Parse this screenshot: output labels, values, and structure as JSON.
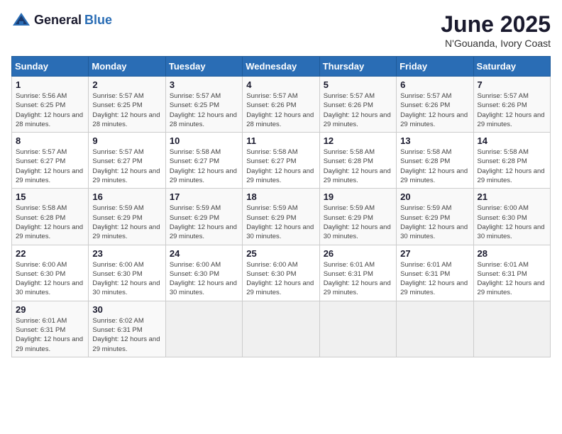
{
  "header": {
    "logo_general": "General",
    "logo_blue": "Blue",
    "month": "June 2025",
    "location": "N'Gouanda, Ivory Coast"
  },
  "weekdays": [
    "Sunday",
    "Monday",
    "Tuesday",
    "Wednesday",
    "Thursday",
    "Friday",
    "Saturday"
  ],
  "weeks": [
    [
      {
        "day": "1",
        "sunrise": "Sunrise: 5:56 AM",
        "sunset": "Sunset: 6:25 PM",
        "daylight": "Daylight: 12 hours and 28 minutes."
      },
      {
        "day": "2",
        "sunrise": "Sunrise: 5:57 AM",
        "sunset": "Sunset: 6:25 PM",
        "daylight": "Daylight: 12 hours and 28 minutes."
      },
      {
        "day": "3",
        "sunrise": "Sunrise: 5:57 AM",
        "sunset": "Sunset: 6:25 PM",
        "daylight": "Daylight: 12 hours and 28 minutes."
      },
      {
        "day": "4",
        "sunrise": "Sunrise: 5:57 AM",
        "sunset": "Sunset: 6:26 PM",
        "daylight": "Daylight: 12 hours and 28 minutes."
      },
      {
        "day": "5",
        "sunrise": "Sunrise: 5:57 AM",
        "sunset": "Sunset: 6:26 PM",
        "daylight": "Daylight: 12 hours and 29 minutes."
      },
      {
        "day": "6",
        "sunrise": "Sunrise: 5:57 AM",
        "sunset": "Sunset: 6:26 PM",
        "daylight": "Daylight: 12 hours and 29 minutes."
      },
      {
        "day": "7",
        "sunrise": "Sunrise: 5:57 AM",
        "sunset": "Sunset: 6:26 PM",
        "daylight": "Daylight: 12 hours and 29 minutes."
      }
    ],
    [
      {
        "day": "8",
        "sunrise": "Sunrise: 5:57 AM",
        "sunset": "Sunset: 6:27 PM",
        "daylight": "Daylight: 12 hours and 29 minutes."
      },
      {
        "day": "9",
        "sunrise": "Sunrise: 5:57 AM",
        "sunset": "Sunset: 6:27 PM",
        "daylight": "Daylight: 12 hours and 29 minutes."
      },
      {
        "day": "10",
        "sunrise": "Sunrise: 5:58 AM",
        "sunset": "Sunset: 6:27 PM",
        "daylight": "Daylight: 12 hours and 29 minutes."
      },
      {
        "day": "11",
        "sunrise": "Sunrise: 5:58 AM",
        "sunset": "Sunset: 6:27 PM",
        "daylight": "Daylight: 12 hours and 29 minutes."
      },
      {
        "day": "12",
        "sunrise": "Sunrise: 5:58 AM",
        "sunset": "Sunset: 6:28 PM",
        "daylight": "Daylight: 12 hours and 29 minutes."
      },
      {
        "day": "13",
        "sunrise": "Sunrise: 5:58 AM",
        "sunset": "Sunset: 6:28 PM",
        "daylight": "Daylight: 12 hours and 29 minutes."
      },
      {
        "day": "14",
        "sunrise": "Sunrise: 5:58 AM",
        "sunset": "Sunset: 6:28 PM",
        "daylight": "Daylight: 12 hours and 29 minutes."
      }
    ],
    [
      {
        "day": "15",
        "sunrise": "Sunrise: 5:58 AM",
        "sunset": "Sunset: 6:28 PM",
        "daylight": "Daylight: 12 hours and 29 minutes."
      },
      {
        "day": "16",
        "sunrise": "Sunrise: 5:59 AM",
        "sunset": "Sunset: 6:29 PM",
        "daylight": "Daylight: 12 hours and 29 minutes."
      },
      {
        "day": "17",
        "sunrise": "Sunrise: 5:59 AM",
        "sunset": "Sunset: 6:29 PM",
        "daylight": "Daylight: 12 hours and 29 minutes."
      },
      {
        "day": "18",
        "sunrise": "Sunrise: 5:59 AM",
        "sunset": "Sunset: 6:29 PM",
        "daylight": "Daylight: 12 hours and 30 minutes."
      },
      {
        "day": "19",
        "sunrise": "Sunrise: 5:59 AM",
        "sunset": "Sunset: 6:29 PM",
        "daylight": "Daylight: 12 hours and 30 minutes."
      },
      {
        "day": "20",
        "sunrise": "Sunrise: 5:59 AM",
        "sunset": "Sunset: 6:29 PM",
        "daylight": "Daylight: 12 hours and 30 minutes."
      },
      {
        "day": "21",
        "sunrise": "Sunrise: 6:00 AM",
        "sunset": "Sunset: 6:30 PM",
        "daylight": "Daylight: 12 hours and 30 minutes."
      }
    ],
    [
      {
        "day": "22",
        "sunrise": "Sunrise: 6:00 AM",
        "sunset": "Sunset: 6:30 PM",
        "daylight": "Daylight: 12 hours and 30 minutes."
      },
      {
        "day": "23",
        "sunrise": "Sunrise: 6:00 AM",
        "sunset": "Sunset: 6:30 PM",
        "daylight": "Daylight: 12 hours and 30 minutes."
      },
      {
        "day": "24",
        "sunrise": "Sunrise: 6:00 AM",
        "sunset": "Sunset: 6:30 PM",
        "daylight": "Daylight: 12 hours and 30 minutes."
      },
      {
        "day": "25",
        "sunrise": "Sunrise: 6:00 AM",
        "sunset": "Sunset: 6:30 PM",
        "daylight": "Daylight: 12 hours and 29 minutes."
      },
      {
        "day": "26",
        "sunrise": "Sunrise: 6:01 AM",
        "sunset": "Sunset: 6:31 PM",
        "daylight": "Daylight: 12 hours and 29 minutes."
      },
      {
        "day": "27",
        "sunrise": "Sunrise: 6:01 AM",
        "sunset": "Sunset: 6:31 PM",
        "daylight": "Daylight: 12 hours and 29 minutes."
      },
      {
        "day": "28",
        "sunrise": "Sunrise: 6:01 AM",
        "sunset": "Sunset: 6:31 PM",
        "daylight": "Daylight: 12 hours and 29 minutes."
      }
    ],
    [
      {
        "day": "29",
        "sunrise": "Sunrise: 6:01 AM",
        "sunset": "Sunset: 6:31 PM",
        "daylight": "Daylight: 12 hours and 29 minutes."
      },
      {
        "day": "30",
        "sunrise": "Sunrise: 6:02 AM",
        "sunset": "Sunset: 6:31 PM",
        "daylight": "Daylight: 12 hours and 29 minutes."
      },
      null,
      null,
      null,
      null,
      null
    ]
  ]
}
